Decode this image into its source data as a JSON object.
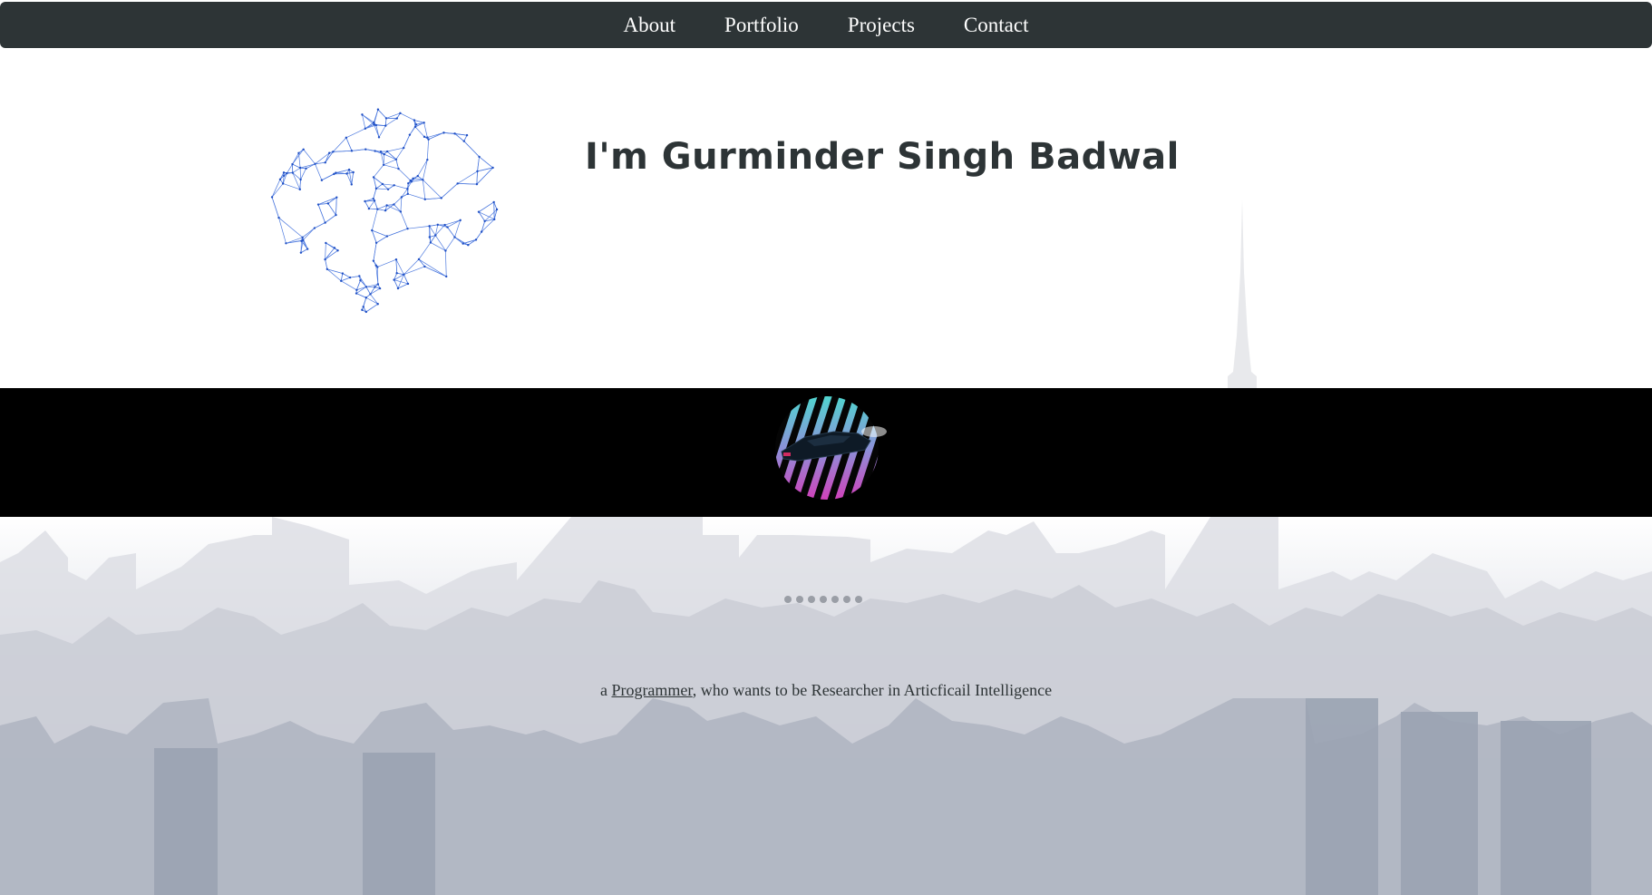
{
  "nav": {
    "items": [
      {
        "label": "About"
      },
      {
        "label": "Portfolio"
      },
      {
        "label": "Projects"
      },
      {
        "label": "Contact"
      }
    ]
  },
  "hero": {
    "headline": "I'm Gurminder Singh Badwal",
    "illustration_icon": "network-brain-icon"
  },
  "band": {
    "badge_icon": "retro-car-sunset-icon"
  },
  "tagline": {
    "prefix": "a ",
    "highlight": "Programmer",
    "suffix": ", who wants to be Researcher in Articficail Intelligence"
  },
  "loader": {
    "dot_count": 7
  },
  "colors": {
    "nav_bg": "#2d3436",
    "text": "#2d3436",
    "brain_lines": "#2f63d9",
    "band_bg": "#000000"
  }
}
